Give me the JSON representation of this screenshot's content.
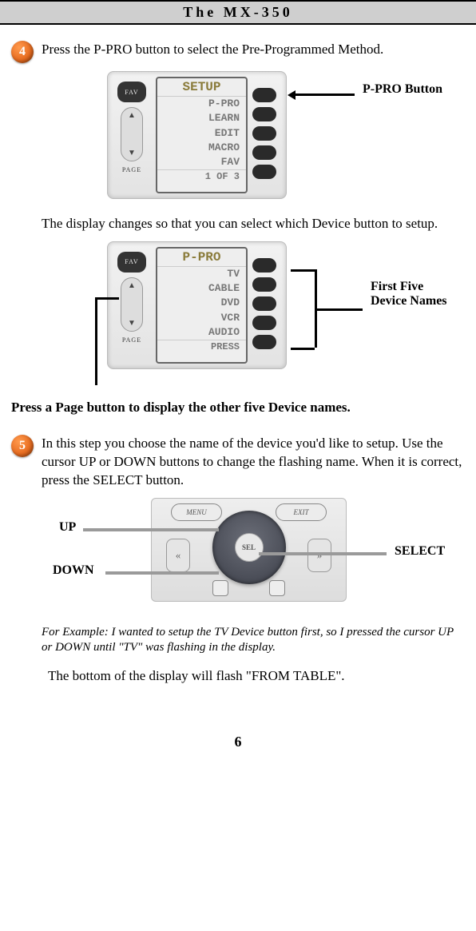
{
  "header": {
    "title": "The MX-350"
  },
  "steps": {
    "s4": {
      "num": "4",
      "text": "Press the P-PRO button to select the Pre-Programmed Method."
    },
    "s5": {
      "num": "5",
      "text": "In this step you choose the name of the device you'd like to setup. Use the cursor UP or DOWN buttons to change the flashing name. When it is correct, press the SELECT button."
    }
  },
  "paragraphs": {
    "after4": "The display changes so that you can select which Device button to setup.",
    "pressPage": "Press a Page button to display the other five Device names.",
    "example": "For Example: I wanted to setup the TV Device button first, so I pressed the cursor UP or DOWN until \"TV\" was flashing in the display.",
    "bottom": "The bottom of the display will flash \"FROM TABLE\"."
  },
  "fig1": {
    "annot": "P-PRO Button",
    "fav": "FAV",
    "page": "PAGE",
    "lcd_title": "SETUP",
    "rows": [
      "P-PRO",
      "LEARN",
      "EDIT",
      "MACRO",
      "FAV"
    ],
    "foot": "1 OF 3"
  },
  "fig2": {
    "annot": "First Five Device Names",
    "fav": "FAV",
    "page": "PAGE",
    "lcd_title": "P-PRO",
    "rows": [
      "TV",
      "CABLE",
      "DVD",
      "VCR",
      "AUDIO"
    ],
    "foot": "PRESS"
  },
  "fig3": {
    "up": "UP",
    "down": "DOWN",
    "select": "SELECT",
    "menu": "MENU",
    "exit": "EXIT",
    "sel": "SEL"
  },
  "pagenum": "6"
}
